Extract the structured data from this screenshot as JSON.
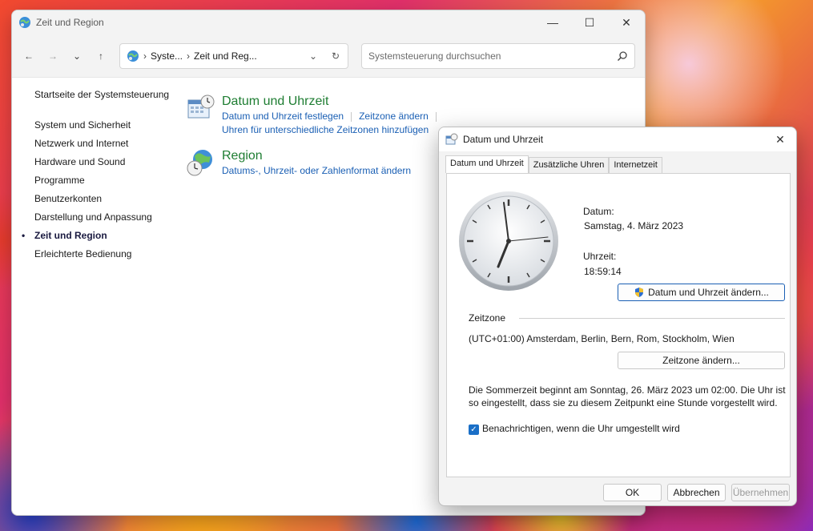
{
  "window": {
    "title": "Zeit und Region",
    "minimize": "—",
    "maximize": "☐",
    "close": "✕"
  },
  "nav": {
    "back": "←",
    "forward": "→",
    "recent": "⌄",
    "up": "↑",
    "breadcrumb": [
      "Syste...",
      "Zeit und Reg..."
    ],
    "separator": "›",
    "dropdown": "⌄",
    "refresh": "↻",
    "search_placeholder": "Systemsteuerung durchsuchen"
  },
  "sidebar": {
    "home": "Startseite der Systemsteuerung",
    "items": [
      "System und Sicherheit",
      "Netzwerk und Internet",
      "Hardware und Sound",
      "Programme",
      "Benutzerkonten",
      "Darstellung und Anpassung",
      "Zeit und Region",
      "Erleichterte Bedienung"
    ],
    "active_index": 6,
    "bullet": "•"
  },
  "categories": {
    "datetime": {
      "title": "Datum und Uhrzeit",
      "link1": "Datum und Uhrzeit festlegen",
      "link2": "Zeitzone ändern",
      "link3": "Uhren für unterschiedliche Zeitzonen hinzufügen"
    },
    "region": {
      "title": "Region",
      "link1": "Datums-, Uhrzeit- oder Zahlenformat ändern"
    }
  },
  "dialog": {
    "title": "Datum und Uhrzeit",
    "close": "✕",
    "tabs": [
      "Datum und Uhrzeit",
      "Zusätzliche Uhren",
      "Internetzeit"
    ],
    "date_label": "Datum:",
    "date_value": "Samstag, 4. März 2023",
    "time_label": "Uhrzeit:",
    "time_value": "18:59:14",
    "change_datetime_button": "Datum und Uhrzeit ändern...",
    "timezone_heading": "Zeitzone",
    "timezone_value": "(UTC+01:00) Amsterdam, Berlin, Bern, Rom, Stockholm, Wien",
    "change_timezone_button": "Zeitzone ändern...",
    "dst_line1": "Die Sommerzeit beginnt am Sonntag, 26. März 2023 um 02:00. Die Uhr ist",
    "dst_line2": "so eingestellt, dass sie zu diesem Zeitpunkt eine Stunde vorgestellt wird.",
    "notify_checkbox": "Benachrichtigen, wenn die Uhr umgestellt wird",
    "notify_checked": true,
    "check_mark": "✓",
    "ok_button": "OK",
    "cancel_button": "Abbrechen",
    "apply_button": "Übernehmen"
  },
  "colors": {
    "link": "#1a5fb4",
    "category_title": "#1e7d32",
    "accent": "#1a6fc7"
  }
}
